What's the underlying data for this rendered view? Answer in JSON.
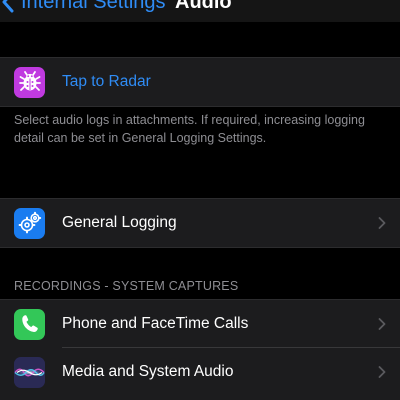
{
  "nav": {
    "back_label": "Internal Settings",
    "title": "Audio"
  },
  "radar": {
    "label": "Tap to Radar",
    "footer": "Select audio logs in attachments. If required, increasing logging detail can be set in General Logging Settings."
  },
  "logging": {
    "label": "General Logging"
  },
  "recordings": {
    "header": "RECORDINGS - SYSTEM CAPTURES",
    "items": [
      {
        "label": "Phone and FaceTime Calls"
      },
      {
        "label": "Media and System Audio"
      }
    ]
  },
  "colors": {
    "accent_blue": "#2f8cf5",
    "radar_icon": "#c03ae0",
    "logging_icon": "#1a7cf0",
    "phone_icon": "#33c758"
  }
}
